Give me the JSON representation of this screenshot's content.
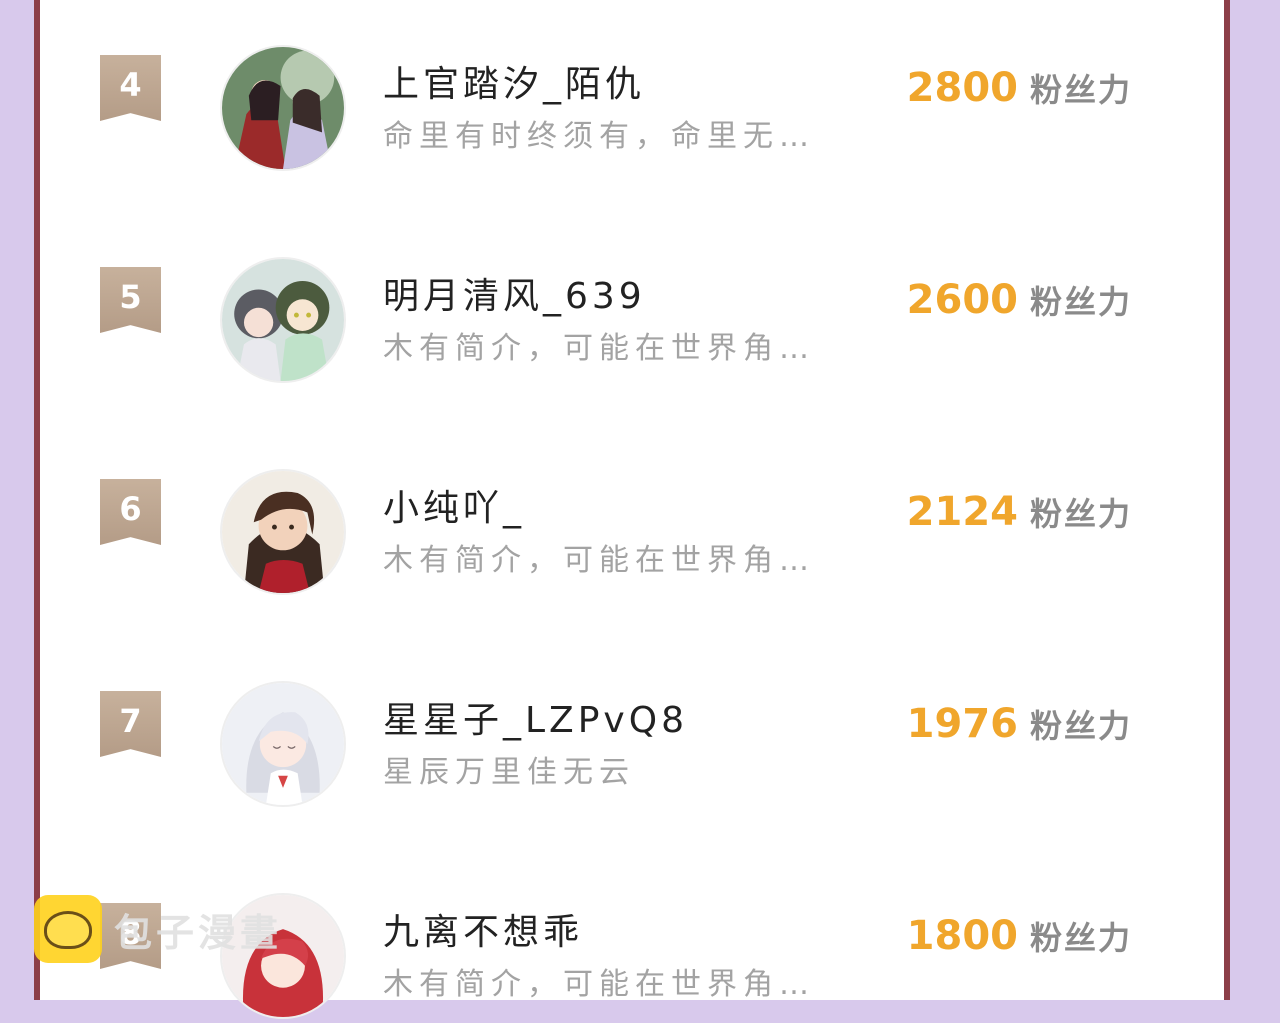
{
  "unit_label": "粉丝力",
  "colors": {
    "background": "#d8c9ec",
    "frame": "#8c3e48",
    "score": "#f0a62c",
    "ribbon": "#c2ab96"
  },
  "ranking": [
    {
      "rank": "4",
      "name": "上官踏汐_陌仇",
      "bio": "命里有时终须有，命里无…",
      "score": "2800",
      "avatar_icon": "avatar-red-robed-couple"
    },
    {
      "rank": "5",
      "name": "明月清风_639",
      "bio": "木有简介，可能在世界角…",
      "score": "2600",
      "avatar_icon": "avatar-chibi-pair"
    },
    {
      "rank": "6",
      "name": "小纯吖_",
      "bio": "木有简介，可能在世界角…",
      "score": "2124",
      "avatar_icon": "avatar-dark-haired-youth"
    },
    {
      "rank": "7",
      "name": "星星子_LZPvQ8",
      "bio": "星辰万里佳无云",
      "score": "1976",
      "avatar_icon": "avatar-white-haired-girl"
    },
    {
      "rank": "8",
      "name": "九离不想乖",
      "bio": "木有简介，可能在世界角…",
      "score": "1800",
      "avatar_icon": "avatar-red-haired-chibi"
    }
  ],
  "watermark": {
    "text": "包子漫畫",
    "logo_icon": "bun-logo-icon"
  }
}
